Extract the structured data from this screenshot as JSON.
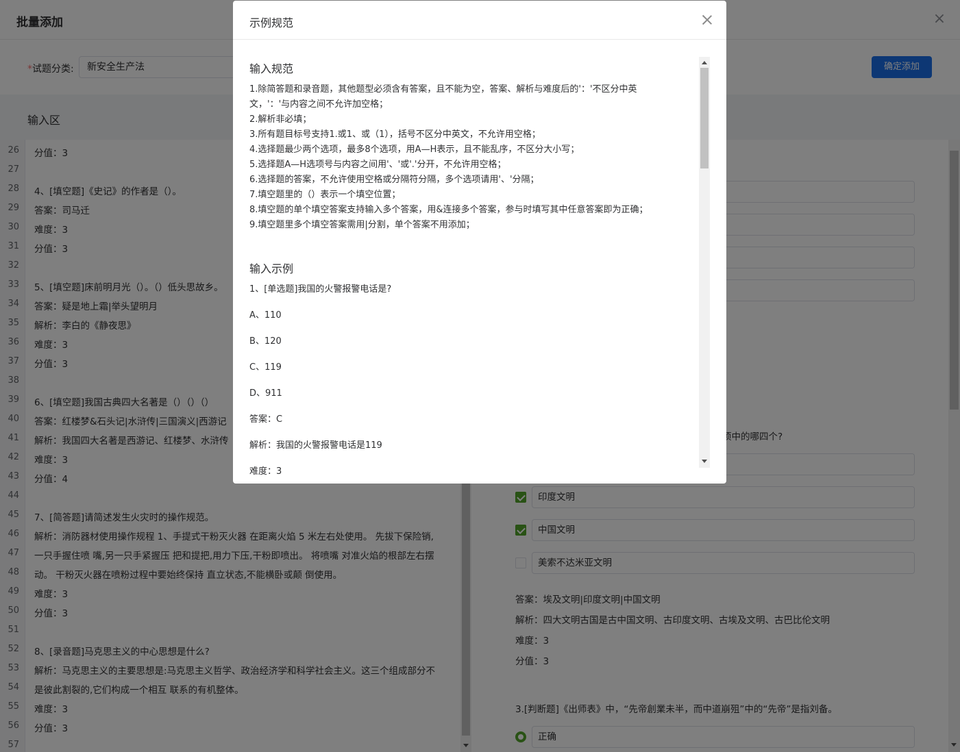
{
  "page": {
    "title": "批量添加",
    "category_label": "试题分类:",
    "category_required_mark": "*",
    "category_value": "新安全生产法",
    "confirm_label": "确定添加",
    "input_section_title": "输入区"
  },
  "editor": {
    "lines": [
      {
        "n": "26",
        "t": "分值：3"
      },
      {
        "n": "27",
        "t": ""
      },
      {
        "n": "28",
        "t": "4、[填空题]《史记》的作者是（）。"
      },
      {
        "n": "29",
        "t": "答案：司马迁"
      },
      {
        "n": "30",
        "t": "难度：3"
      },
      {
        "n": "31",
        "t": "分值：3"
      },
      {
        "n": "32",
        "t": ""
      },
      {
        "n": "33",
        "t": "5、[填空题]床前明月光（）。（）低头思故乡。"
      },
      {
        "n": "34",
        "t": "答案：疑是地上霜|举头望明月"
      },
      {
        "n": "35",
        "t": "解析：李白的《静夜思》"
      },
      {
        "n": "36",
        "t": "难度：3"
      },
      {
        "n": "37",
        "t": "分值：3"
      },
      {
        "n": "38",
        "t": ""
      },
      {
        "n": "39",
        "t": "6、[填空题]我国古典四大名著是（）（）（）"
      },
      {
        "n": "40",
        "t": "答案：红楼梦&石头记|水浒传|三国演义|西游记"
      },
      {
        "n": "41",
        "t": "解析：我国四大名著是西游记、红楼梦、水浒传"
      },
      {
        "n": "42",
        "t": "难度：3"
      },
      {
        "n": "43",
        "t": "分值：4"
      },
      {
        "n": "44",
        "t": ""
      },
      {
        "n": "45",
        "t": "7、[简答题]请简述发生火灾时的操作规范。"
      },
      {
        "n": "46",
        "t": "解析：消防器材使用操作规程 1、手提式干粉灭火器 在距离火焰 5 米左右处使用。 先拔下保险销,"
      },
      {
        "n": "47",
        "t": "一只手握住喷 嘴,另一只手紧握压 把和提把,用力下压,干粉即喷出。 将喷嘴 对准火焰的根部左右摆"
      },
      {
        "n": "48",
        "t": "动。 干粉灭火器在喷粉过程中要始终保持 直立状态,不能横卧或颠 倒使用。"
      },
      {
        "n": "49",
        "t": "难度：3"
      },
      {
        "n": "50",
        "t": "分值：3"
      },
      {
        "n": "51",
        "t": ""
      },
      {
        "n": "52",
        "t": "8、[录音题]马克思主义的中心思想是什么?"
      },
      {
        "n": "53",
        "t": "解析：马克思主义的主要思想是:马克思主义哲学、政治经济学和科学社会主义。这三个组成部分不"
      },
      {
        "n": "54",
        "t": "是彼此割裂的,它们构成一个相互 联系的有机整体。"
      },
      {
        "n": "55",
        "t": "难度：3"
      },
      {
        "n": "56",
        "t": "分值：3"
      },
      {
        "n": "57",
        "t": ""
      }
    ]
  },
  "preview": {
    "q2_tail": "项中的哪四个?",
    "options": [
      {
        "label": "",
        "checked": false
      },
      {
        "label": "印度文明",
        "checked": true
      },
      {
        "label": "中国文明",
        "checked": true
      },
      {
        "label": "美索不达米亚文明",
        "checked": false
      }
    ],
    "answer": "答案：埃及文明|印度文明|中国文明",
    "analysis": "解析：四大文明古国是古中国文明、古印度文明、古埃及文明、古巴比伦文明",
    "difficulty": "难度：3",
    "score": "分值：3",
    "q3": "3.[判断题]《出师表》中，“先帝創業未半，而中道崩殂”中的“先帝”是指刘备。",
    "q3_option": "正确"
  },
  "modal": {
    "title": "示例规范",
    "rules_heading": "输入规范",
    "rules": [
      "1.除简答题和录音题，其他题型必须含有答案，且不能为空，答案、解析与难度后的'：'不区分中英",
      "文，'：'与内容之间不允许加空格；",
      "2.解析非必填；",
      "3.所有题目标号支持1.或1、或（1），括号不区分中英文，不允许用空格；",
      "4.选择题最少两个选项，最多8个选项，用A—H表示，且不能乱序，不区分大小写；",
      "5.选择题A—H选项号与内容之间用'、'或'.'分开，不允许用空格；",
      "6.选择题的答案，不允许使用空格或分隔符分隔，多个选项请用'、'分隔；",
      "7.填空题里的（）表示一个填空位置；",
      "8.填空题的单个填空答案支持输入多个答案，用&连接多个答案，参与时填写其中任意答案即为正确；",
      "9.填空题里多个填空答案需用|分割，单个答案不用添加；"
    ],
    "example_heading": "输入示例",
    "example": [
      "1、[单选题]我国的火警报警电话是?",
      "A、110",
      "B、120",
      "C、119",
      "D、911",
      "答案：C",
      "解析：我国的火警报警电话是119",
      "难度：3"
    ]
  }
}
